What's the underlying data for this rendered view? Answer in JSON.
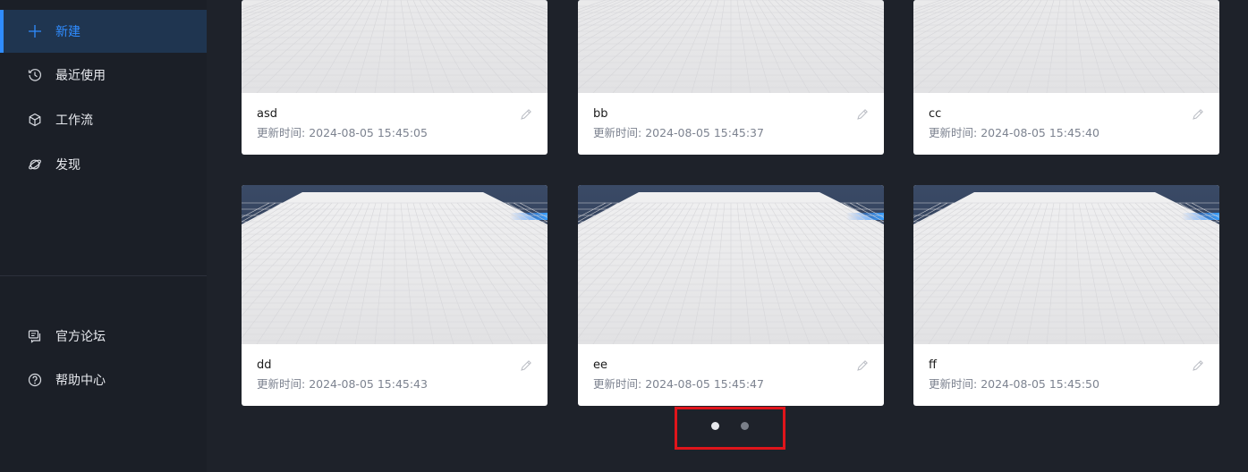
{
  "sidebar": {
    "items": [
      {
        "label": "新建",
        "icon": "plus-icon",
        "active": true
      },
      {
        "label": "最近使用",
        "icon": "history-icon"
      },
      {
        "label": "工作流",
        "icon": "cube-icon"
      },
      {
        "label": "发现",
        "icon": "planet-icon"
      }
    ],
    "bottom_items": [
      {
        "label": "官方论坛",
        "icon": "forum-icon"
      },
      {
        "label": "帮助中心",
        "icon": "help-icon"
      }
    ]
  },
  "meta": "更新时间:",
  "cards": [
    {
      "name": "asd",
      "time": "2024-08-05 15:45:05"
    },
    {
      "name": "bb",
      "time": "2024-08-05 15:45:37"
    },
    {
      "name": "cc",
      "time": "2024-08-05 15:45:40"
    },
    {
      "name": "dd",
      "time": "2024-08-05 15:45:43"
    },
    {
      "name": "ee",
      "time": "2024-08-05 15:45:47"
    },
    {
      "name": "ff",
      "time": "2024-08-05 15:45:50"
    }
  ],
  "dots": {
    "active": 0
  },
  "colors": {
    "accent": "#2f8cff",
    "highlight": "#e0151b",
    "sidebar": "#1b1f27",
    "bg": "#1e222a"
  }
}
